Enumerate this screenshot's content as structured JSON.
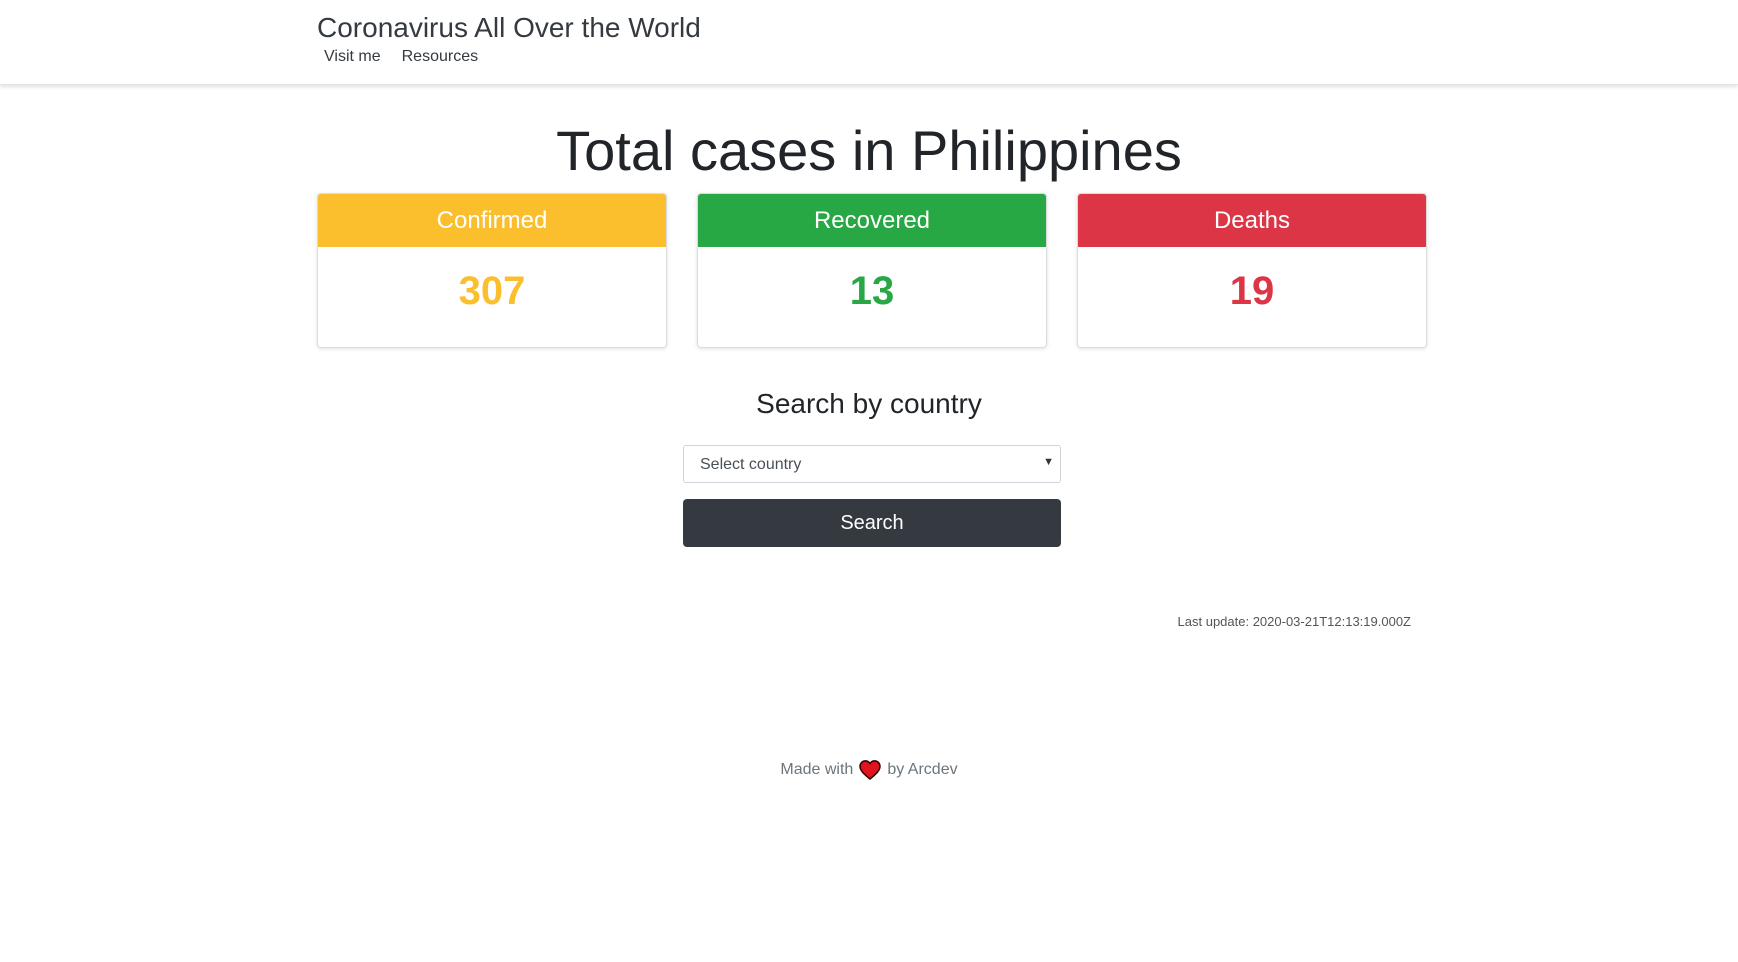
{
  "navbar": {
    "brand": "Coronavirus All Over the World",
    "links": [
      {
        "label": "Visit me"
      },
      {
        "label": "Resources"
      }
    ]
  },
  "main": {
    "title": "Total cases in Philippines",
    "cards": [
      {
        "label": "Confirmed",
        "value": "307",
        "color": "#fbbf2e"
      },
      {
        "label": "Recovered",
        "value": "13",
        "color": "#28a745"
      },
      {
        "label": "Deaths",
        "value": "19",
        "color": "#dc3545"
      }
    ]
  },
  "search": {
    "title": "Search by country",
    "select_value": "Select country",
    "button_label": "Search"
  },
  "last_update": "Last update: 2020-03-21T12:13:19.000Z",
  "footer": {
    "prefix": "Made with",
    "icon": "heart-icon",
    "suffix": "by Arcdev"
  }
}
